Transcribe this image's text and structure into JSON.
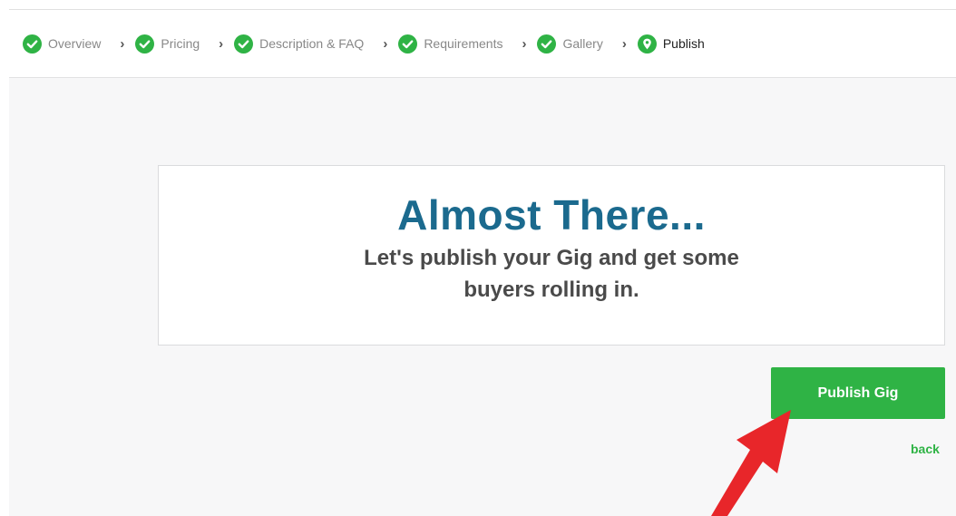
{
  "stepper": {
    "steps": [
      {
        "label": "Overview",
        "status": "complete",
        "icon": "check-circle-icon"
      },
      {
        "label": "Pricing",
        "status": "complete",
        "icon": "check-circle-icon"
      },
      {
        "label": "Description & FAQ",
        "status": "complete",
        "icon": "check-circle-icon"
      },
      {
        "label": "Requirements",
        "status": "complete",
        "icon": "check-circle-icon"
      },
      {
        "label": "Gallery",
        "status": "complete",
        "icon": "check-circle-icon"
      },
      {
        "label": "Publish",
        "status": "current",
        "icon": "location-pin-icon"
      }
    ],
    "separator": "›"
  },
  "card": {
    "title": "Almost There...",
    "subtitle": "Let's publish your Gig and get some buyers rolling in."
  },
  "actions": {
    "publish_label": "Publish Gig",
    "back_label": "back"
  },
  "colors": {
    "accent_green": "#2fb345",
    "title_blue": "#1b6a8e",
    "annotation_red": "#e8262a"
  }
}
